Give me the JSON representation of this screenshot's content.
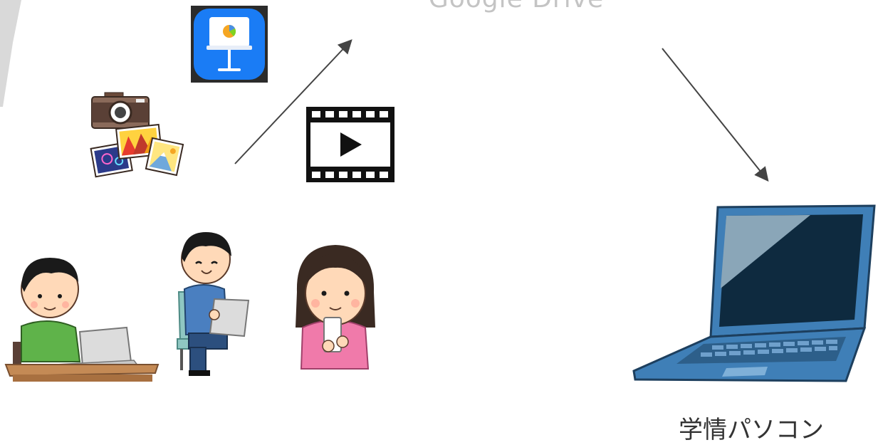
{
  "cloud": {
    "label": "Google Drive"
  },
  "destination": {
    "label": "学情パソコン"
  },
  "colors": {
    "keynote_blue": "#1a7cf5",
    "laptop_blue": "#3f7fb7",
    "arrow": "#444444"
  }
}
